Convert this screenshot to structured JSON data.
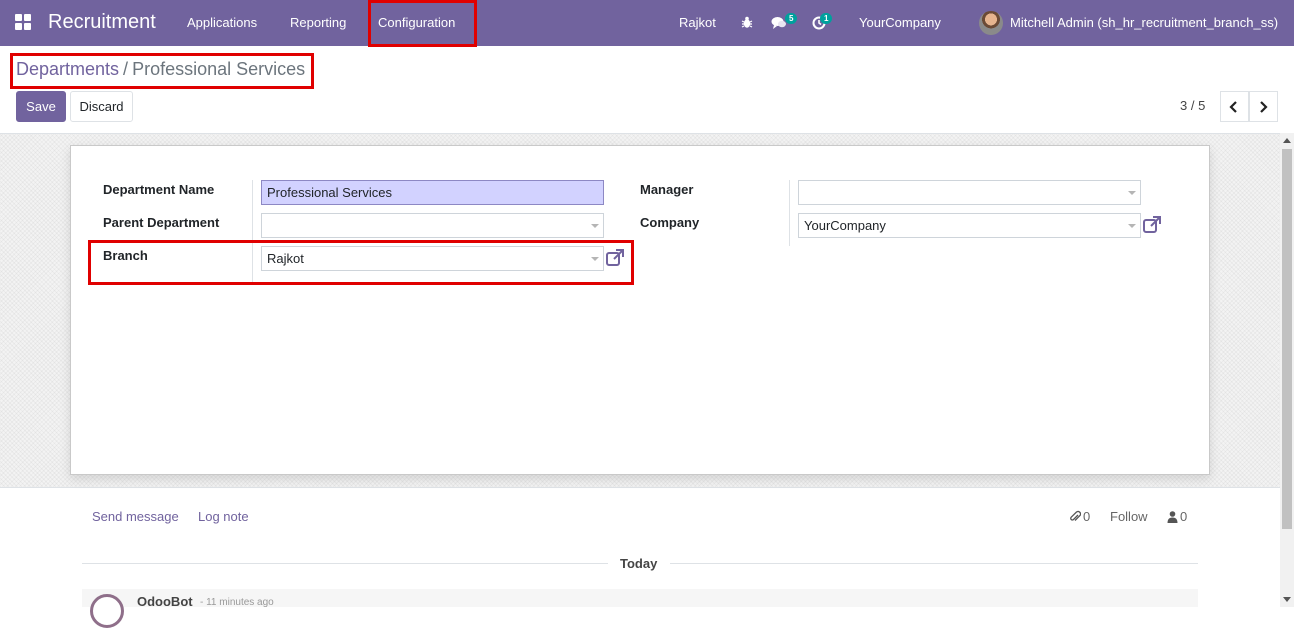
{
  "navbar": {
    "app_title": "Recruitment",
    "menu": [
      "Applications",
      "Reporting",
      "Configuration"
    ],
    "branch": "Rajkot",
    "messages_count": "5",
    "activities_count": "1",
    "company": "YourCompany",
    "user": "Mitchell Admin (sh_hr_recruitment_branch_ss)"
  },
  "breadcrumb": {
    "parent": "Departments",
    "separator": "/",
    "current": "Professional Services"
  },
  "buttons": {
    "save": "Save",
    "discard": "Discard"
  },
  "pager": {
    "value": "3 / 5"
  },
  "form": {
    "department_name_label": "Department Name",
    "department_name_value": "Professional Services",
    "parent_department_label": "Parent Department",
    "parent_department_value": "",
    "branch_label": "Branch",
    "branch_value": "Rajkot",
    "manager_label": "Manager",
    "manager_value": "",
    "company_label": "Company",
    "company_value": "YourCompany"
  },
  "chatter": {
    "send_message": "Send message",
    "log_note": "Log note",
    "attachments_count": "0",
    "follow": "Follow",
    "followers_count": "0",
    "today": "Today",
    "author": "OdooBot",
    "time": "- 11 minutes ago"
  },
  "colors": {
    "brand": "#71639e",
    "highlight": "#e00000",
    "required_field": "#d2d2ff",
    "badge": "#00a09d"
  }
}
